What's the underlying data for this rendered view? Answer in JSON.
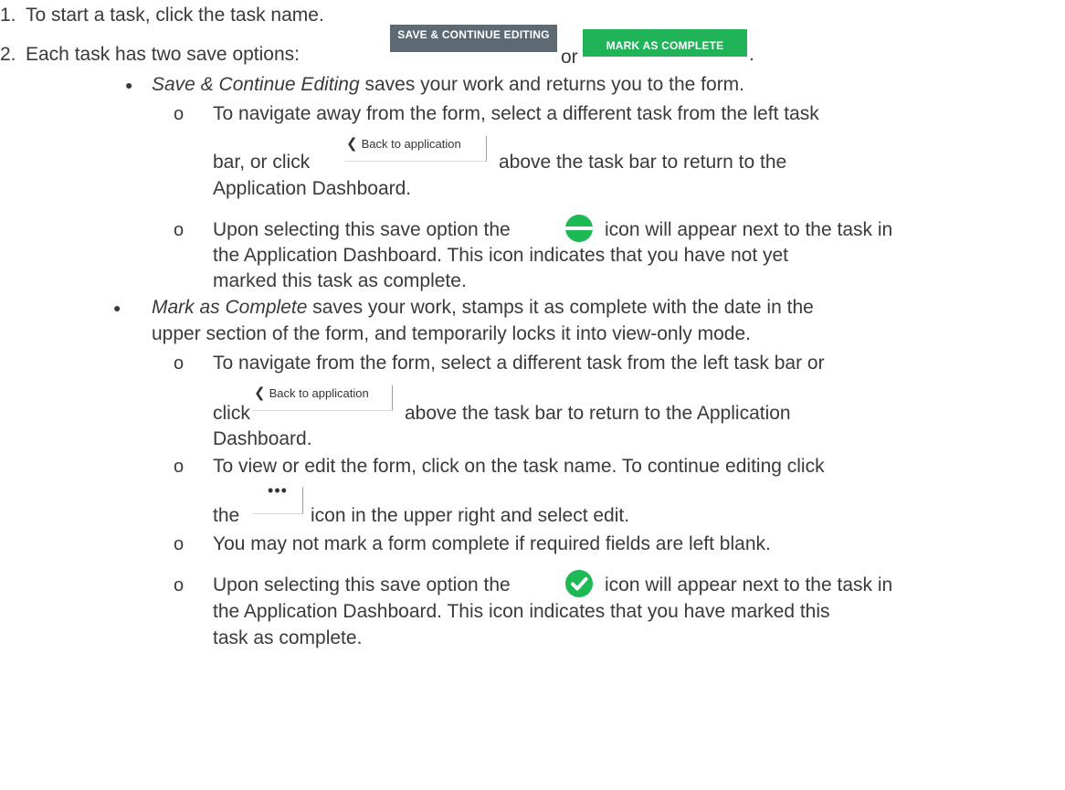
{
  "step1": {
    "number": "1.",
    "text": "To start a task, click the task name."
  },
  "step2": {
    "number": "2.",
    "text_before": "Each task has two save options:",
    "text_or": "or",
    "text_end": "."
  },
  "buttons": {
    "save_continue": "SAVE & CONTINUE EDITING",
    "mark_complete": "MARK AS COMPLETE",
    "back_to_application": "Back to application",
    "more_dots": "•••"
  },
  "bullet_save": {
    "title": "Save & Continue Editing",
    "text": " saves your work and returns you to the form.",
    "sub1": {
      "line1": "To navigate away from the form, select a different task from the left task",
      "line2_before": "bar, or click",
      "line2_after": "above the task bar to return to the",
      "line3": "Application Dashboard."
    },
    "sub2": {
      "line1_before": "Upon selecting this save option the",
      "line1_after": "icon will appear next to the task in",
      "line2": "the Application Dashboard. This icon indicates that you have not yet",
      "line3": "marked this task as complete."
    }
  },
  "bullet_complete": {
    "title": "Mark as Complete",
    "line1_text": " saves your work, stamps it as complete with the date in the",
    "line2": "upper section of the form, and temporarily locks it into view-only mode.",
    "sub1": {
      "line1": "To navigate from the form, select a different task from the left task bar or",
      "line2_before": "click",
      "line2_after": "above the task bar to return to the Application",
      "line3": "Dashboard."
    },
    "sub2": {
      "line1": "To view or edit the form, click on the task name. To continue editing click",
      "line2_before": "the",
      "line2_after": "icon in the upper right and select edit."
    },
    "sub3": {
      "line1": "You may not mark a form complete if required fields are left blank."
    },
    "sub4": {
      "line1_before": "Upon selecting this save option the",
      "line1_after": "icon will appear next to the task in",
      "line2": "the Application Dashboard. This icon indicates that you have marked this",
      "line3": "task as complete."
    }
  },
  "markers": {
    "bullet": "●",
    "circle": "o"
  },
  "colors": {
    "save_button": "#5d6a73",
    "complete_button": "#20b358",
    "icon_green": "#1db954"
  }
}
